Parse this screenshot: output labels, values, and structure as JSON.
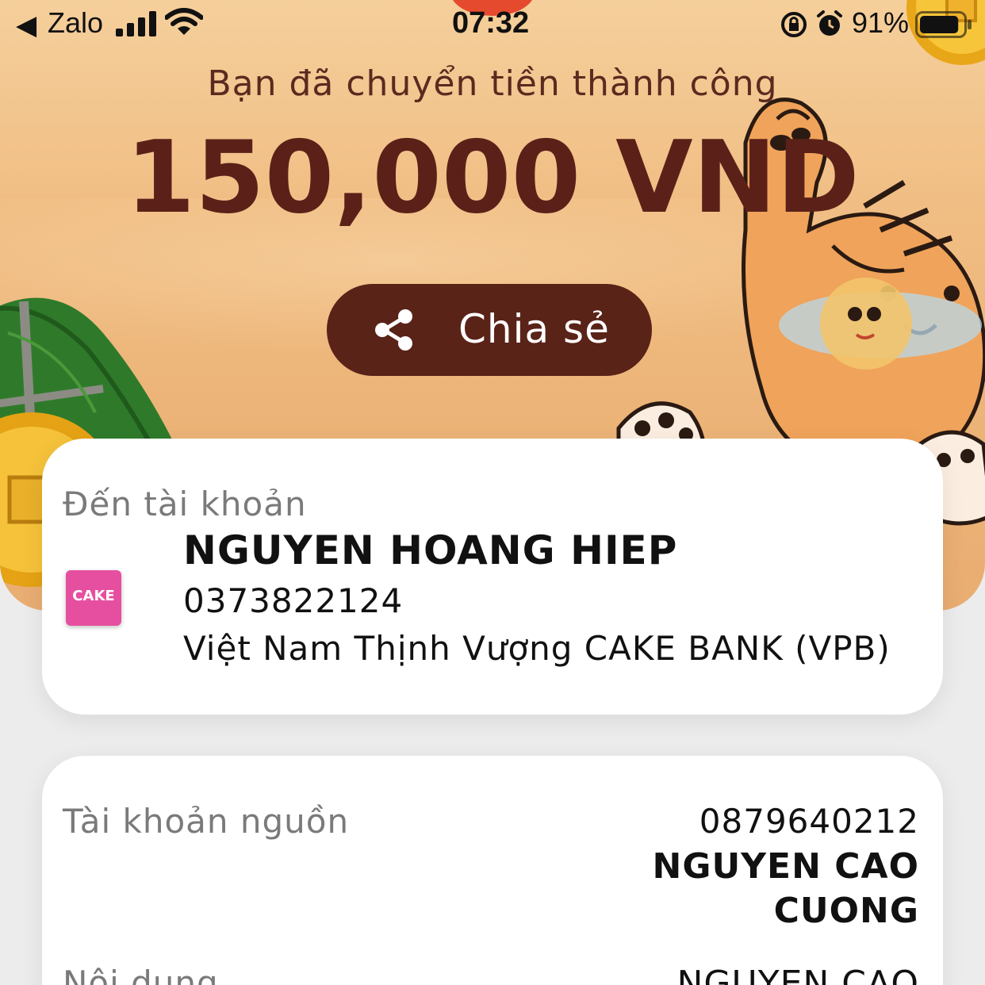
{
  "status_bar": {
    "back_app": "Zalo",
    "time": "07:32",
    "battery_percent": "91%",
    "battery_level": 0.91
  },
  "result": {
    "subtitle": "Bạn đã chuyển tiền thành công",
    "amount": "150,000 VND",
    "share_label": "Chia sẻ"
  },
  "recipient": {
    "section_label": "Đến tài khoản",
    "bank_logo_text": "CAKE",
    "name": "NGUYEN HOANG HIEP",
    "account_number": "0373822124",
    "bank_name": "Việt Nam Thịnh Vượng CAKE BANK (VPB)"
  },
  "source": {
    "section_label": "Tài khoản nguồn",
    "account_number": "0879640212",
    "name": "NGUYEN CAO CUONG"
  },
  "content": {
    "section_label": "Nội dung",
    "value": "NGUYEN CAO"
  },
  "colors": {
    "brand_brown": "#5a2318",
    "hero_background": "#f0bd83",
    "bank_logo_pink": "#e64fa0"
  },
  "icons": {
    "back": "back-arrow-icon",
    "signal": "cellular-signal-icon",
    "wifi": "wifi-icon",
    "orientation_lock": "orientation-lock-icon",
    "alarm": "alarm-icon",
    "battery": "battery-icon",
    "share": "share-icon"
  }
}
